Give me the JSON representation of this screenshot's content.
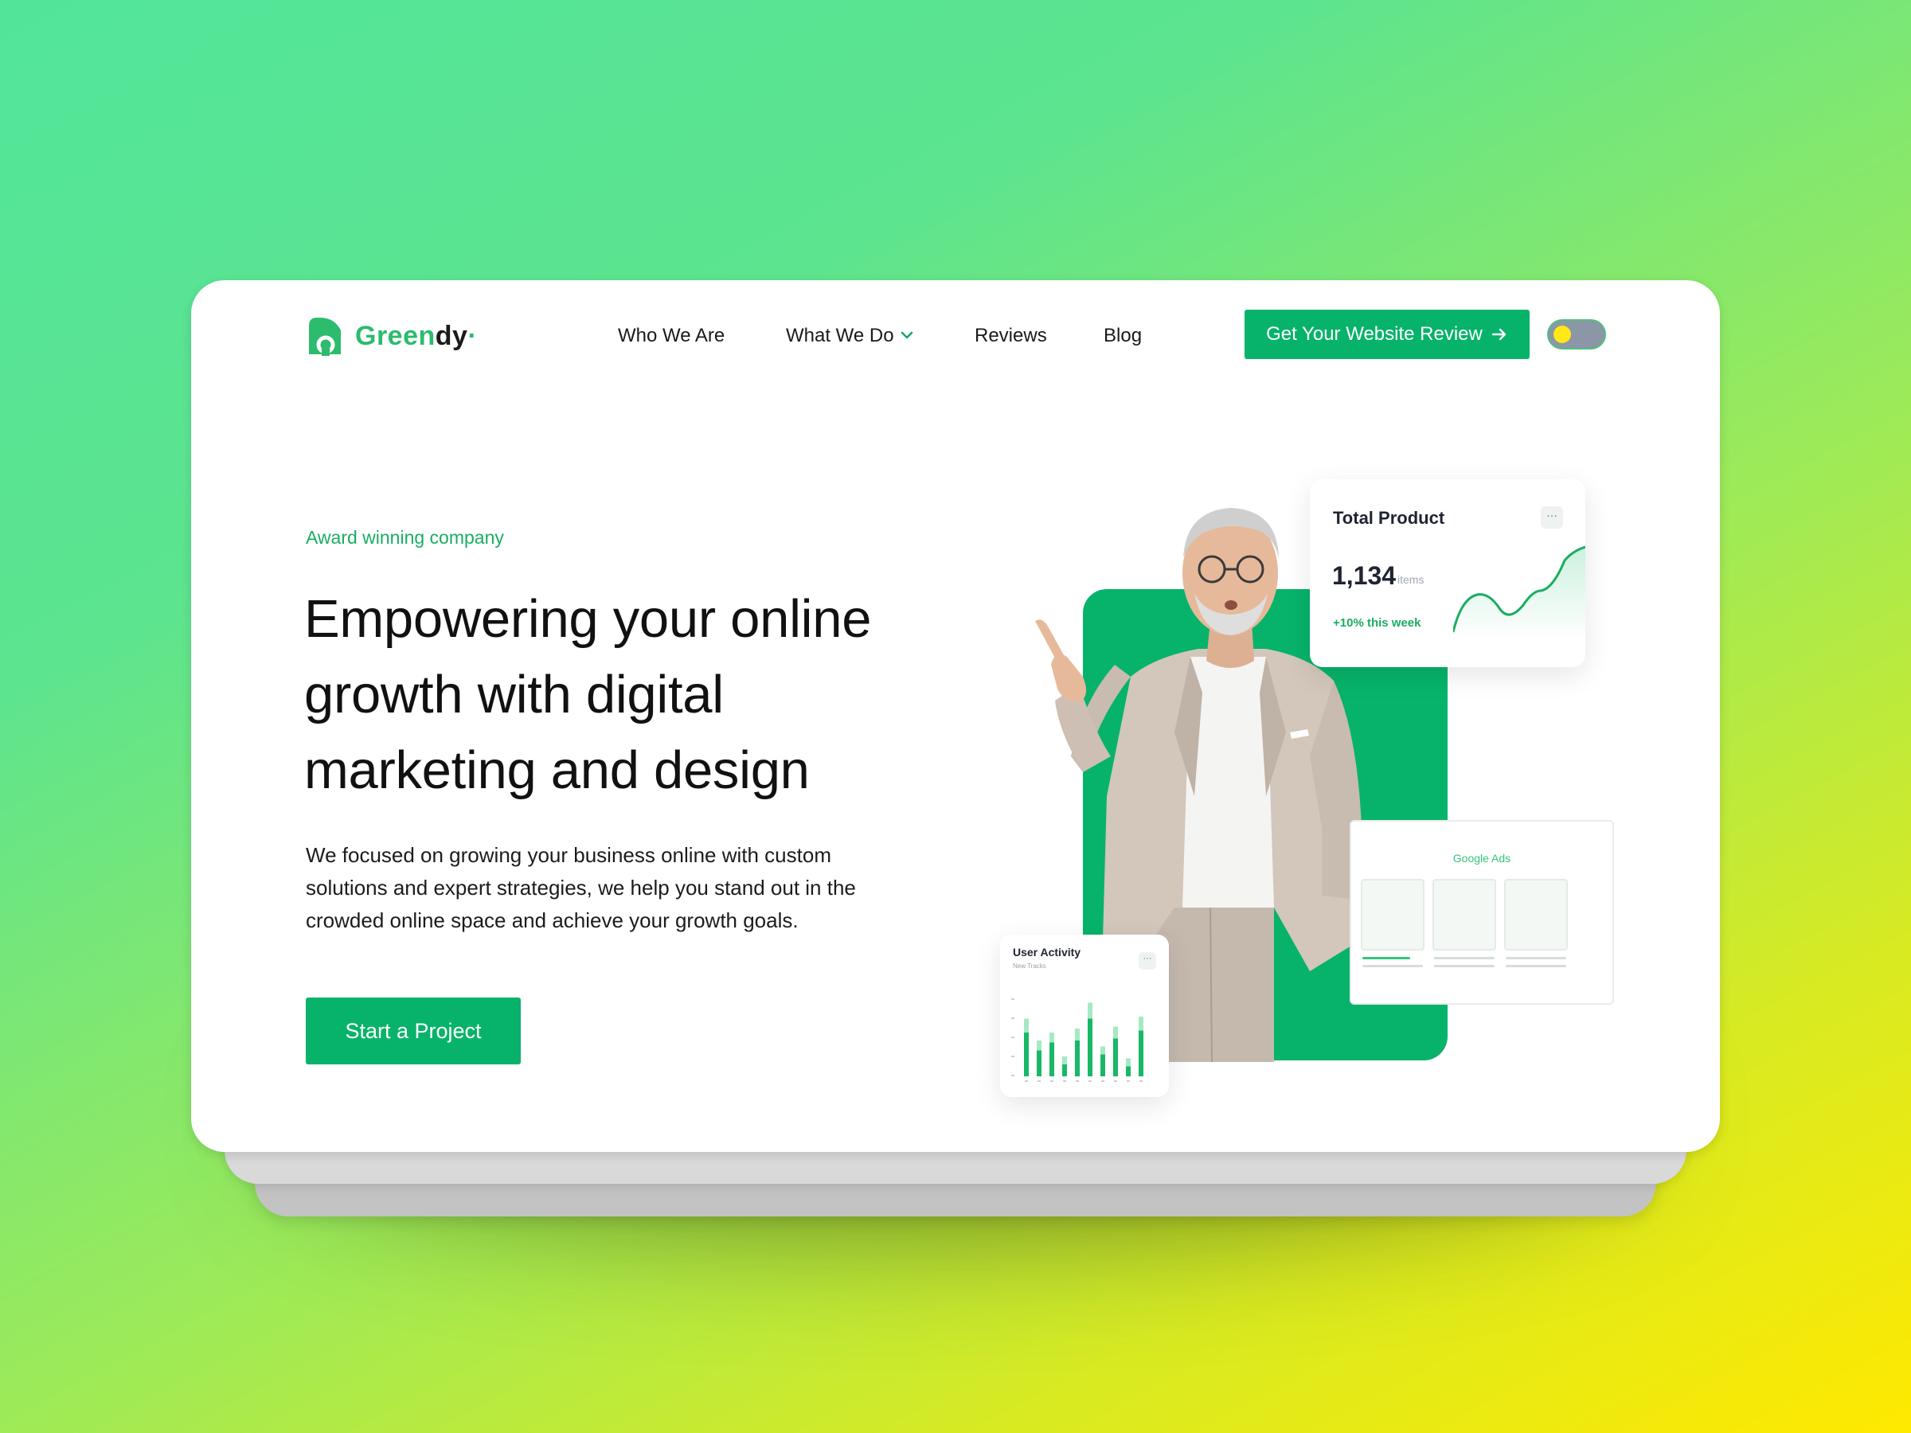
{
  "brand": {
    "name_part1": "Green",
    "name_part2": "dy",
    "accent_color": "#07b36a"
  },
  "nav": {
    "items": [
      {
        "label": "Who We Are"
      },
      {
        "label": "What We Do"
      },
      {
        "label": "Reviews"
      },
      {
        "label": "Blog"
      }
    ],
    "cta_label": "Get Your Website Review",
    "theme_toggle": {
      "state": "off",
      "knob_color": "#ffe815"
    }
  },
  "hero": {
    "eyebrow": "Award winning company",
    "headline": "Empowering your online growth with digital marketing and design",
    "description": "We focused on growing your business online with custom solutions and expert strategies, we help you stand out in the crowded online space and achieve your growth goals.",
    "cta_label": "Start a Project"
  },
  "widgets": {
    "total_product": {
      "title": "Total Product",
      "menu": "···",
      "value": "1,134",
      "unit": "items",
      "trend": "+10% this week"
    },
    "google_ads": {
      "title": "Google Ads"
    },
    "user_activity": {
      "title": "User Activity",
      "subtitle": "New Tracks",
      "menu": "···"
    }
  },
  "chart_data": {
    "type": "bar",
    "series": [
      {
        "values": [
          58,
          36,
          44,
          20,
          48,
          74,
          30,
          50,
          18,
          60
        ]
      },
      {
        "values": [
          44,
          26,
          34,
          12,
          36,
          58,
          22,
          38,
          10,
          46
        ]
      }
    ]
  }
}
